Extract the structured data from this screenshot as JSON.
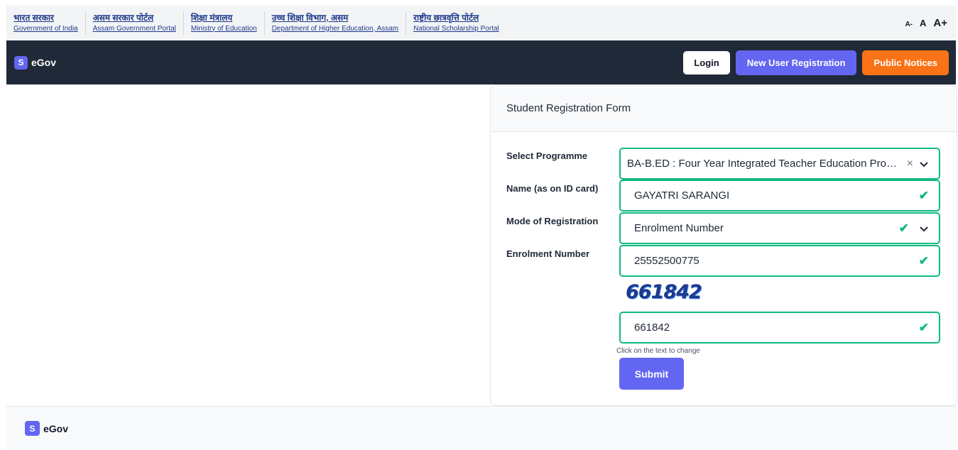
{
  "gov_links": [
    {
      "hindi": "भारत सरकार",
      "english": "Government of India"
    },
    {
      "hindi": "असम सरकार पोर्टल",
      "english": "Assam Government Portal"
    },
    {
      "hindi": "शिक्षा मंत्रालय",
      "english": "Ministry of Education"
    },
    {
      "hindi": "उच्च शिक्षा विभाग, असम",
      "english": "Department of Higher Education, Assam"
    },
    {
      "hindi": "राष्ट्रीय छात्रवृत्ति पोर्टल",
      "english": "National Scholarship Portal"
    }
  ],
  "font_size": {
    "decrease": "A-",
    "normal": "A",
    "increase": "A+"
  },
  "nav": {
    "logo_letter": "S",
    "brand": "eGov",
    "login": "Login",
    "new_user": "New User Registration",
    "public_notices": "Public Notices"
  },
  "form": {
    "title": "Student Registration Form",
    "programme_label": "Select Programme",
    "programme_value": "BA-B.ED : Four Year Integrated Teacher Education Programme",
    "name_label": "Name (as on ID card)",
    "name_value": "GAYATRI SARANGI",
    "mode_label": "Mode of Registration",
    "mode_value": "Enrolment Number",
    "enrolment_label": "Enrolment Number",
    "enrolment_value": "25552500775",
    "captcha_text": "661842",
    "captcha_input": "661842",
    "captcha_hint": "Click on the text to change",
    "submit": "Submit"
  },
  "footer": {
    "logo_letter": "S",
    "brand": "eGov"
  },
  "colors": {
    "accent": "#6366f1",
    "orange": "#f97316",
    "success": "#10b981",
    "navbar": "#1f2937"
  },
  "icons": [
    "check-icon",
    "clear-icon",
    "chevron-down-icon"
  ]
}
